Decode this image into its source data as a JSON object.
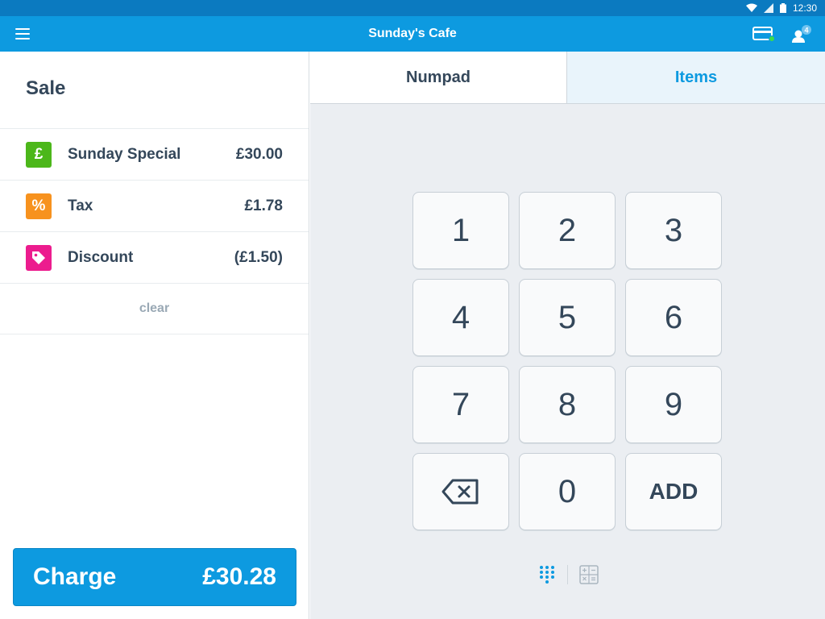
{
  "status_bar": {
    "time": "12:30"
  },
  "app_bar": {
    "title": "Sunday's Cafe",
    "notification_count": "4"
  },
  "sale": {
    "title": "Sale",
    "items": [
      {
        "icon": "pound-icon",
        "icon_glyph": "£",
        "icon_color": "#4cb71a",
        "label": "Sunday Special",
        "amount": "£30.00"
      },
      {
        "icon": "percent-icon",
        "icon_glyph": "%",
        "icon_color": "#f7921e",
        "label": "Tax",
        "amount": "£1.78"
      },
      {
        "icon": "tag-icon",
        "icon_glyph": "",
        "icon_color": "#ec1c8e",
        "label": "Discount",
        "amount": "(£1.50)"
      }
    ],
    "clear_label": "clear",
    "charge_label": "Charge",
    "charge_amount": "£30.28"
  },
  "tabs": [
    {
      "label": "Numpad",
      "active": true
    },
    {
      "label": "Items",
      "active": false
    }
  ],
  "numpad": {
    "keys": [
      "1",
      "2",
      "3",
      "4",
      "5",
      "6",
      "7",
      "8",
      "9",
      "backspace",
      "0",
      "ADD"
    ]
  },
  "colors": {
    "primary": "#0d9ae0",
    "status_bar": "#0b7ac0",
    "text": "#34475a",
    "panel_bg": "#ebeef2"
  }
}
